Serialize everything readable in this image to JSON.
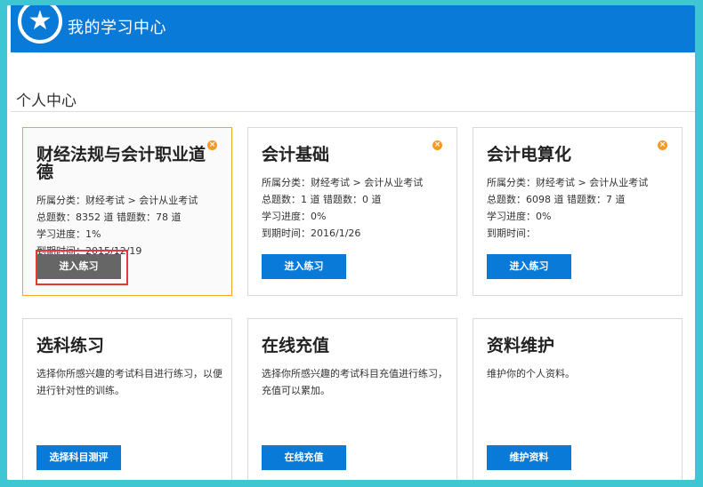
{
  "header": {
    "title": "我的学习中心",
    "logo_icon": "star-icon"
  },
  "section": {
    "title": "个人中心"
  },
  "courses": [
    {
      "title": "财经法规与会计职业道德",
      "category": "所属分类：财经考试 > 会计从业考试",
      "counts": "总题数：8352 道    错题数：78 道",
      "progress": "学习进度：1%",
      "expire": "到期时间：2015/12/19",
      "button": "进入练习"
    },
    {
      "title": "会计基础",
      "category": "所属分类：财经考试 > 会计从业考试",
      "counts": "总题数：1 道    错题数：0 道",
      "progress": "学习进度：0%",
      "expire": "到期时间：2016/1/26",
      "button": "进入练习"
    },
    {
      "title": "会计电算化",
      "category": "所属分类：财经考试 > 会计从业考试",
      "counts": "总题数：6098 道    错题数：7 道",
      "progress": "学习进度：0%",
      "expire": "到期时间：",
      "button": "进入练习"
    }
  ],
  "actions": [
    {
      "title": "选科练习",
      "desc": "选择你所感兴趣的考试科目进行练习，以便进行针对性的训练。",
      "button": "选择科目测评"
    },
    {
      "title": "在线充值",
      "desc": "选择你所感兴趣的考试科目充值进行练习，充值可以累加。",
      "button": "在线充值"
    },
    {
      "title": "资料维护",
      "desc": "维护你的个人资料。",
      "button": "维护资料"
    }
  ],
  "colors": {
    "primary": "#0a7ad8",
    "active_border": "#f5a623",
    "highlight": "#e53935"
  }
}
